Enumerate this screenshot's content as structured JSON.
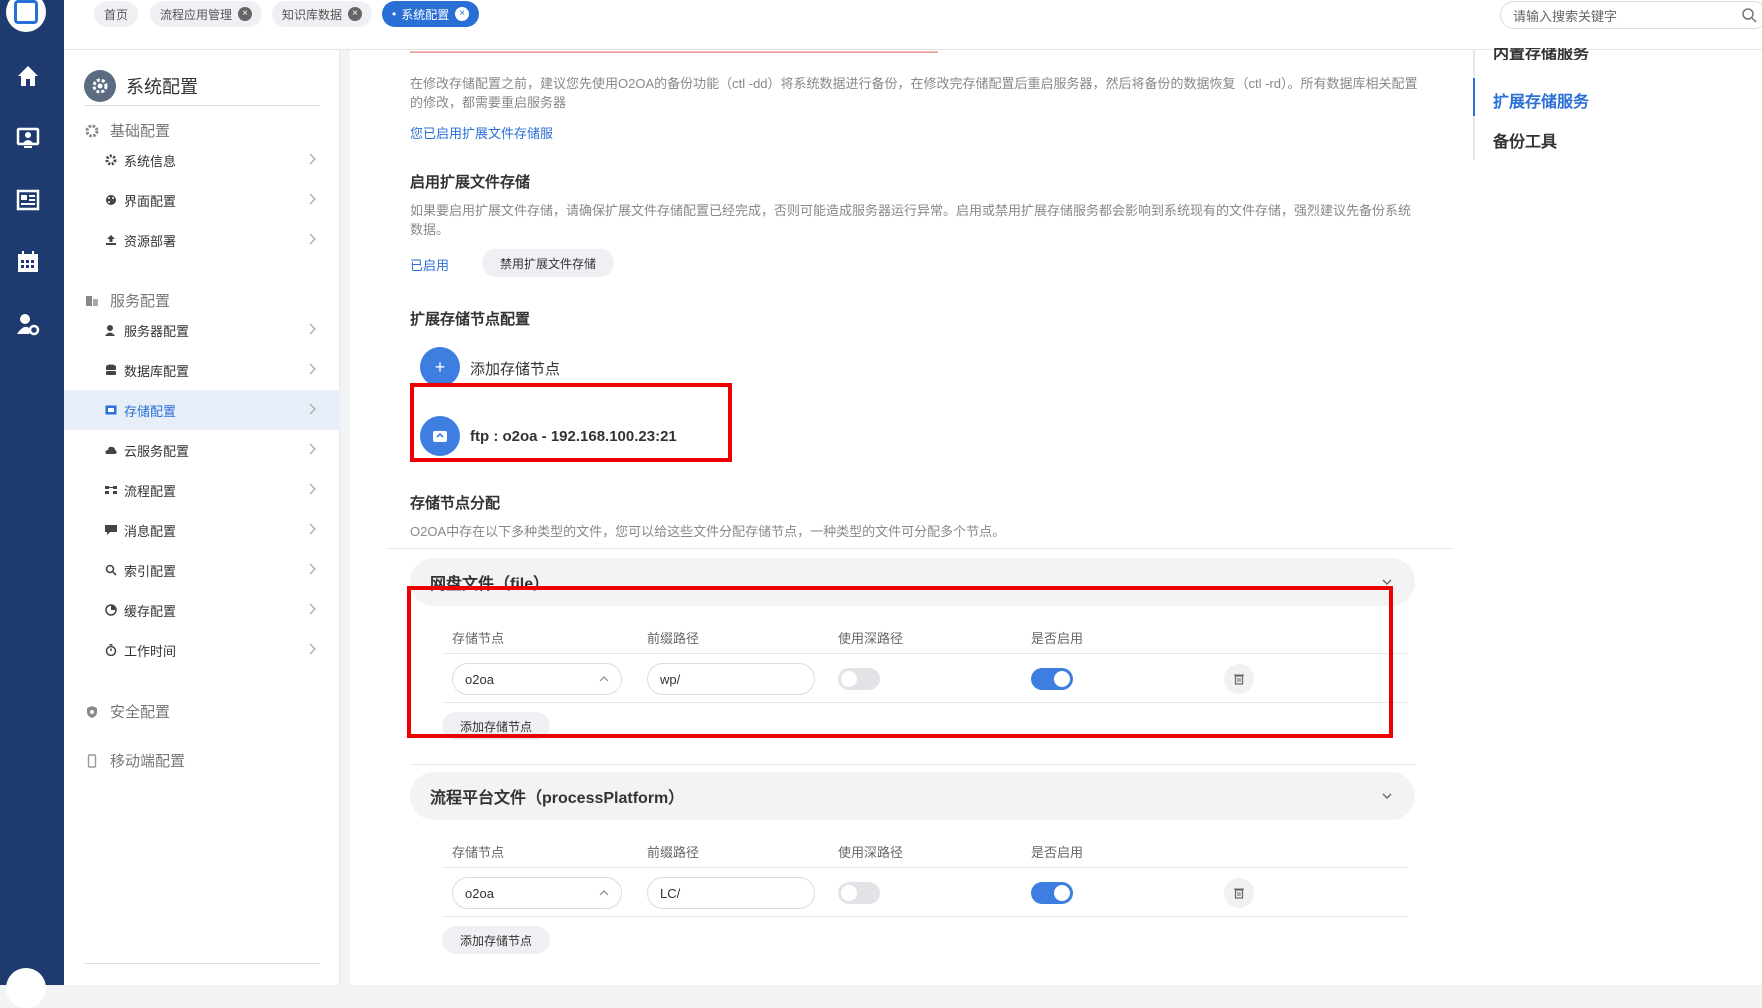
{
  "tabs": [
    {
      "label": "首页",
      "closable": false
    },
    {
      "label": "流程应用管理",
      "closable": true
    },
    {
      "label": "知识库数据",
      "closable": true
    },
    {
      "label": "系统配置",
      "closable": true,
      "active": true
    }
  ],
  "search": {
    "placeholder": "请输入搜索关键字"
  },
  "sidebar": {
    "title": "系统配置",
    "groups": {
      "basic": "基础配置",
      "service": "服务配置",
      "security": "安全配置",
      "mobile": "移动端配置"
    },
    "items": [
      {
        "label": "系统信息",
        "icon": "gear-icon"
      },
      {
        "label": "界面配置",
        "icon": "palette-icon"
      },
      {
        "label": "资源部署",
        "icon": "upload-icon"
      },
      {
        "label": "服务器配置",
        "icon": "server-user-icon"
      },
      {
        "label": "数据库配置",
        "icon": "database-icon"
      },
      {
        "label": "存储配置",
        "icon": "storage-icon",
        "active": true
      },
      {
        "label": "云服务配置",
        "icon": "cloud-icon"
      },
      {
        "label": "流程配置",
        "icon": "flow-icon"
      },
      {
        "label": "消息配置",
        "icon": "message-icon"
      },
      {
        "label": "索引配置",
        "icon": "search-icon"
      },
      {
        "label": "缓存配置",
        "icon": "pie-icon"
      },
      {
        "label": "工作时间",
        "icon": "timer-icon"
      }
    ]
  },
  "main": {
    "note1": "在修改存储配置之前，建议您先使用O2OA的备份功能（ctl -dd）将系统数据进行备份，在修改完存储配置后重启服务器，然后将备份的数据恢复（ctl -rd）。所有数据库相关配置的修改，都需要重启服务器",
    "enabled_link": "您已启用扩展文件存储服",
    "ext_title": "启用扩展文件存储",
    "ext_note": "如果要启用扩展文件存储，请确保扩展文件存储配置已经完成，否则可能造成服务器运行异常。启用或禁用扩展存储服务都会影响到系统现有的文件存储，强烈建议先备份系统数据。",
    "ext_status": "已启用",
    "ext_button": "禁用扩展文件存储",
    "node_title": "扩展存储节点配置",
    "add_node_plus": "+",
    "add_node_label": "添加存储节点",
    "node_item": "ftp : o2oa - 192.168.100.23:21",
    "assign_title": "存储节点分配",
    "assign_note": "O2OA中存在以下多种类型的文件，您可以给这些文件分配存储节点，一种类型的文件可分配多个节点。",
    "sections": [
      {
        "title": "网盘文件（file）",
        "headers": [
          "存储节点",
          "前缀路径",
          "使用深路径",
          "是否启用"
        ],
        "row": {
          "node": "o2oa",
          "prefix": "wp/",
          "deep_path": false,
          "enabled": true
        },
        "add_button": "添加存储节点"
      },
      {
        "title": "流程平台文件（processPlatform）",
        "headers": [
          "存储节点",
          "前缀路径",
          "使用深路径",
          "是否启用"
        ],
        "row": {
          "node": "o2oa",
          "prefix": "LC/",
          "deep_path": false,
          "enabled": true
        },
        "add_button": "添加存储节点"
      }
    ]
  },
  "anchor_nav": {
    "items": [
      "内置存储服务",
      "扩展存储服务",
      "备份工具"
    ],
    "active": "扩展存储服务"
  },
  "colors": {
    "primary": "#2a6fd6",
    "rail": "#1e3a6e",
    "highlight_box": "#ee0000"
  }
}
